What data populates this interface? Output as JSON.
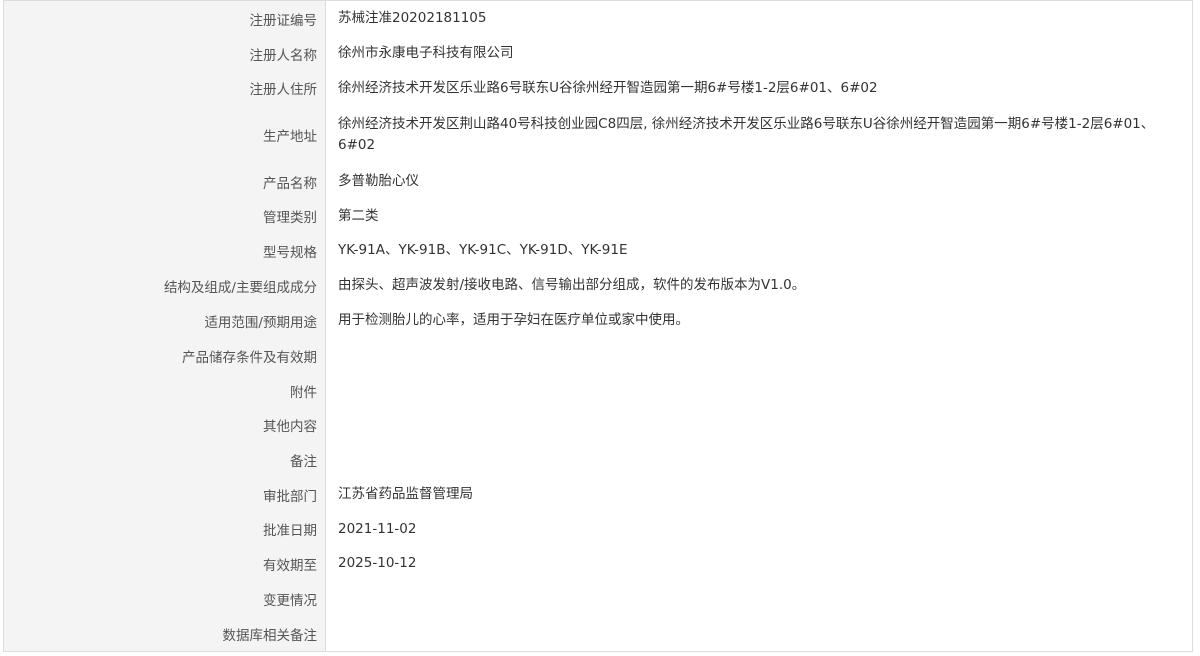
{
  "rows": [
    {
      "label": "注册证编号",
      "value": "苏械注准20202181105"
    },
    {
      "label": "注册人名称",
      "value": "徐州市永康电子科技有限公司"
    },
    {
      "label": "注册人住所",
      "value": "徐州经济技术开发区乐业路6号联东U谷徐州经开智造园第一期6#号楼1-2层6#01、6#02"
    },
    {
      "label": "生产地址",
      "value": "徐州经济技术开发区荆山路40号科技创业园C8四层, 徐州经济技术开发区乐业路6号联东U谷徐州经开智造园第一期6#号楼1-2层6#01、6#02"
    },
    {
      "label": "产品名称",
      "value": "多普勒胎心仪"
    },
    {
      "label": "管理类别",
      "value": "第二类"
    },
    {
      "label": "型号规格",
      "value": "YK-91A、YK-91B、YK-91C、YK-91D、YK-91E"
    },
    {
      "label": "结构及组成/主要组成成分",
      "value": "由探头、超声波发射/接收电路、信号输出部分组成，软件的发布版本为V1.0。"
    },
    {
      "label": "适用范围/预期用途",
      "value": "用于检测胎儿的心率，适用于孕妇在医疗单位或家中使用。"
    },
    {
      "label": "产品储存条件及有效期",
      "value": ""
    },
    {
      "label": "附件",
      "value": ""
    },
    {
      "label": "其他内容",
      "value": ""
    },
    {
      "label": "备注",
      "value": ""
    },
    {
      "label": "审批部门",
      "value": "江苏省药品监督管理局"
    },
    {
      "label": "批准日期",
      "value": "2021-11-02"
    },
    {
      "label": "有效期至",
      "value": "2025-10-12"
    },
    {
      "label": "变更情况",
      "value": ""
    },
    {
      "label": "数据库相关备注",
      "value": ""
    }
  ]
}
